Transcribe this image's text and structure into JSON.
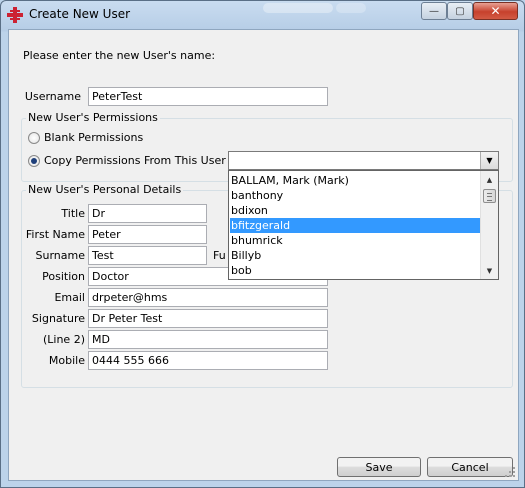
{
  "window": {
    "title": "Create New User",
    "min_glyph": "—",
    "max_glyph": "▢",
    "close_glyph": "✕"
  },
  "prompt": "Please enter the new User's name:",
  "username": {
    "label": "Username",
    "value": "PeterTest"
  },
  "permissions": {
    "group_title": "New User's Permissions",
    "blank_label": "Blank Permissions",
    "blank_selected": false,
    "copy_label": "Copy Permissions From This User",
    "copy_selected": true,
    "combo_value": "",
    "combo_arrow": "▼",
    "dropdown_items": [
      "BALLAM, Mark (Mark)",
      "banthony",
      "bdixon",
      "bfitzgerald",
      "bhumrick",
      "Billyb",
      "bob"
    ],
    "dropdown_selected": "bfitzgerald",
    "scroll_up": "▲",
    "scroll_down": "▼"
  },
  "personal": {
    "group_title": "New User's Personal Details",
    "title": {
      "label": "Title",
      "value": "Dr"
    },
    "first_name": {
      "label": "First Name",
      "value": "Peter"
    },
    "surname": {
      "label": "Surname",
      "value": "Test"
    },
    "full_name_partial": "Fu",
    "position": {
      "label": "Position",
      "value": "Doctor"
    },
    "email": {
      "label": "Email",
      "value": "drpeter@hms"
    },
    "signature": {
      "label": "Signature",
      "value": "Dr Peter Test"
    },
    "line2": {
      "label": "(Line 2)",
      "value": "MD"
    },
    "mobile": {
      "label": "Mobile",
      "value": "0444 555 666"
    }
  },
  "buttons": {
    "save": "Save",
    "cancel": "Cancel"
  },
  "colors": {
    "accent": "#3399ff",
    "icon_red": "#cc2233"
  }
}
